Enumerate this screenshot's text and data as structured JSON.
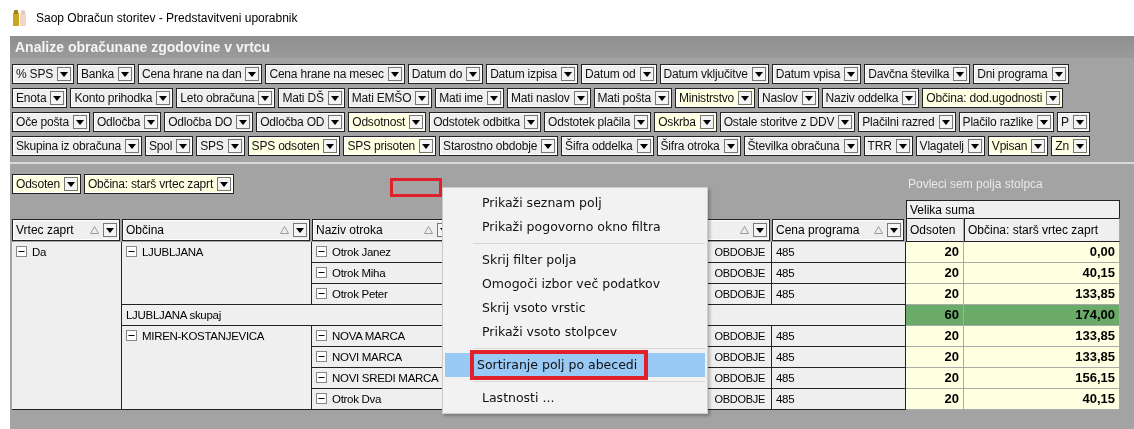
{
  "window": {
    "title": "Saop Obračun storitev - Predstavitveni uporabnik"
  },
  "panel": {
    "title": "Analize obračunane zgodovine v vrtcu"
  },
  "filter_rows": [
    [
      {
        "label": "% SPS",
        "active": false
      },
      {
        "label": "Banka",
        "active": false
      },
      {
        "label": "Cena hrane na dan",
        "active": false
      },
      {
        "label": "Cena hrane na mesec",
        "active": false
      },
      {
        "label": "Datum do",
        "active": false
      },
      {
        "label": "Datum izpisa",
        "active": false
      },
      {
        "label": "Datum od",
        "active": false
      },
      {
        "label": "Datum vključitve",
        "active": false
      },
      {
        "label": "Datum vpisa",
        "active": false
      },
      {
        "label": "Davčna številka",
        "active": false
      },
      {
        "label": "Dni programa",
        "active": false
      }
    ],
    [
      {
        "label": "Enota",
        "active": false
      },
      {
        "label": "Konto prihodka",
        "active": false
      },
      {
        "label": "Leto obračuna",
        "active": false
      },
      {
        "label": "Mati DŠ",
        "active": false
      },
      {
        "label": "Mati EMŠO",
        "active": false
      },
      {
        "label": "Mati ime",
        "active": false
      },
      {
        "label": "Mati naslov",
        "active": false
      },
      {
        "label": "Mati pošta",
        "active": false
      },
      {
        "label": "Ministrstvo",
        "active": true
      },
      {
        "label": "Naslov",
        "active": false
      },
      {
        "label": "Naziv oddelka",
        "active": false
      },
      {
        "label": "Občina: dod.ugodnosti",
        "active": true
      }
    ],
    [
      {
        "label": "Oče pošta",
        "active": false
      },
      {
        "label": "Odločba",
        "active": false
      },
      {
        "label": "Odločba DO",
        "active": false
      },
      {
        "label": "Odločba OD",
        "active": false
      },
      {
        "label": "Odsotnost",
        "active": true
      },
      {
        "label": "Odstotek odbitka",
        "active": false
      },
      {
        "label": "Odstotek plačila",
        "active": false
      },
      {
        "label": "Oskrba",
        "active": true
      },
      {
        "label": "Ostale storitve z DDV",
        "active": false
      },
      {
        "label": "Plačilni razred",
        "active": false
      },
      {
        "label": "Plačilo razlike",
        "active": false
      },
      {
        "label": "P",
        "active": false
      }
    ],
    [
      {
        "label": "Skupina iz obračuna",
        "active": false
      },
      {
        "label": "Spol",
        "active": false
      },
      {
        "label": "SPS",
        "active": false
      },
      {
        "label": "SPS odsoten",
        "active": true
      },
      {
        "label": "SPS prisoten",
        "active": true
      },
      {
        "label": "Starostno obdobje",
        "active": false
      },
      {
        "label": "Šifra oddelka",
        "active": false
      },
      {
        "label": "Šifra otroka",
        "active": false
      },
      {
        "label": "Številka obračuna",
        "active": false
      },
      {
        "label": "TRR",
        "active": false
      },
      {
        "label": "Vlagatelj",
        "active": false
      },
      {
        "label": "Vpisan",
        "active": true
      },
      {
        "label": "Zn",
        "active": true
      }
    ]
  ],
  "data_fields": [
    {
      "label": "Odsoten",
      "active": true
    },
    {
      "label": "Občina: starš vrtec zaprt",
      "active": true
    }
  ],
  "drop_marker_highlighted": true,
  "column_drop_hint": "Povleci sem polja stolpca",
  "row_headers": [
    {
      "label": "Vrtec zaprt"
    },
    {
      "label": "Občina"
    },
    {
      "label": "Naziv otroka"
    },
    {
      "label": "Cena programa"
    }
  ],
  "grand_total_label": "Velika suma",
  "data_headers": [
    "Odsoten",
    "Občina: starš vrtec zaprt"
  ],
  "rows": [
    {
      "label": "Da",
      "expanded": true,
      "children": [
        {
          "label": "LJUBLJANA",
          "expanded": true,
          "children": [
            {
              "label": "Otrok Janez",
              "expanded": true,
              "column_5": "OBDOBJE",
              "price": "485",
              "odsoten": "20",
              "obcina": "0,00"
            },
            {
              "label": "Otrok Miha",
              "expanded": true,
              "column_5": "OBDOBJE",
              "price": "485",
              "odsoten": "20",
              "obcina": "40,15"
            },
            {
              "label": "Otrok Peter",
              "expanded": true,
              "column_5": "OBDOBJE",
              "price": "485",
              "odsoten": "20",
              "obcina": "133,85"
            }
          ],
          "total": {
            "label": "LJUBLJANA skupaj",
            "odsoten": "60",
            "obcina": "174,00"
          }
        },
        {
          "label": "MIREN-KOSTANJEVICA",
          "expanded": true,
          "children": [
            {
              "label": "NOVA MARCA",
              "expanded": true,
              "column_5": "OBDOBJE",
              "price": "485",
              "odsoten": "20",
              "obcina": "133,85"
            },
            {
              "label": "NOVI MARCA",
              "expanded": true,
              "column_5": "OBDOBJE",
              "price": "485",
              "odsoten": "20",
              "obcina": "133,85"
            },
            {
              "label": "NOVI SREDI MARCA",
              "expanded": true,
              "column_5": "OBDOBJE",
              "price": "485",
              "odsoten": "20",
              "obcina": "156,15"
            },
            {
              "label": "Otrok Dva",
              "expanded": true,
              "column_5": "OBDOBJE",
              "price": "485",
              "odsoten": "20",
              "obcina": "40,15"
            }
          ]
        }
      ]
    }
  ],
  "context_menu": [
    {
      "kind": "item",
      "label": "Prikaži seznam polj",
      "selected": false,
      "highlighted": false
    },
    {
      "kind": "item",
      "label": "Prikaži pogovorno okno filtra",
      "selected": false,
      "highlighted": false
    },
    {
      "kind": "separator"
    },
    {
      "kind": "item",
      "label": "Skrij filter polja",
      "selected": false,
      "highlighted": false
    },
    {
      "kind": "item",
      "label": "Omogoči izbor več podatkov",
      "selected": false,
      "highlighted": false
    },
    {
      "kind": "item",
      "label": "Skrij vsoto vrstic",
      "selected": false,
      "highlighted": false
    },
    {
      "kind": "item",
      "label": "Prikaži vsoto stolpcev",
      "selected": false,
      "highlighted": false
    },
    {
      "kind": "separator"
    },
    {
      "kind": "item",
      "label": "Sortiranje polj po abecedi",
      "selected": true,
      "highlighted": true
    },
    {
      "kind": "separator"
    },
    {
      "kind": "item",
      "label": "Lastnosti ...",
      "selected": false,
      "highlighted": false
    }
  ]
}
